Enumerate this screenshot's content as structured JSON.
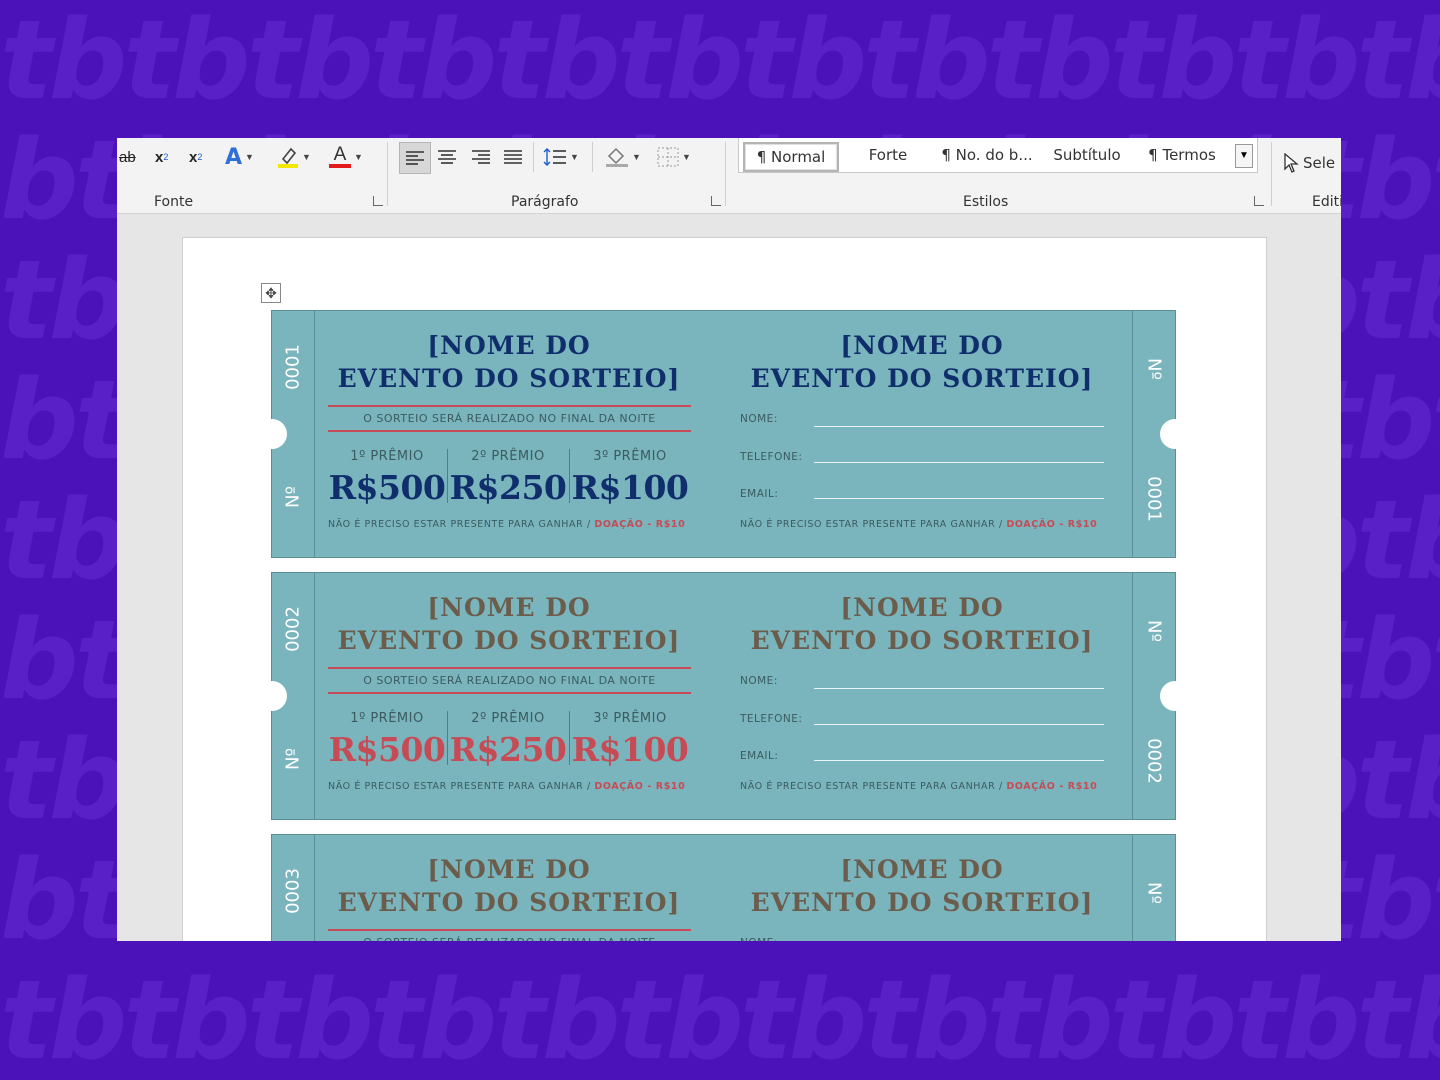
{
  "ribbon": {
    "groups": {
      "font": "Fonte",
      "paragraph": "Parágrafo",
      "styles": "Estilos",
      "editing": "Editi"
    },
    "font_tools": [
      "ab",
      "x",
      "x",
      "A",
      "A"
    ],
    "styles_gallery": [
      "¶ Normal",
      "Forte",
      "¶ No. do b...",
      "Subtítulo",
      "¶ Termos"
    ],
    "editing_select": "Sele"
  },
  "ticket_common": {
    "title_line1": "[NOME DO",
    "title_line2": "EVENTO DO SORTEIO]",
    "subline": "O SORTEIO SERÁ REALIZADO NO FINAL DA NOITE",
    "prize_labels": [
      "1º PRÊMIO",
      "2º PRÊMIO",
      "3º PRÊMIO"
    ],
    "prize_values": [
      "R$500",
      "R$250",
      "R$100"
    ],
    "footnote_main": "NÃO É PRECISO ESTAR PRESENTE PARA GANHAR / ",
    "footnote_red": "DOAÇÃO - R$10",
    "field_name": "NOME:",
    "field_phone": "TELEFONE:",
    "field_email": "EMAIL:",
    "no_label": "Nº"
  },
  "tickets": [
    {
      "number": "0001"
    },
    {
      "number": "0002"
    },
    {
      "number": "0003"
    }
  ],
  "colors": {
    "ticket_bg": "#7ab5bd",
    "title_blue": "#0f2e6b",
    "title_brown": "#6b5c4b",
    "accent_red": "#c74b55",
    "backdrop": "#4a12b8"
  }
}
